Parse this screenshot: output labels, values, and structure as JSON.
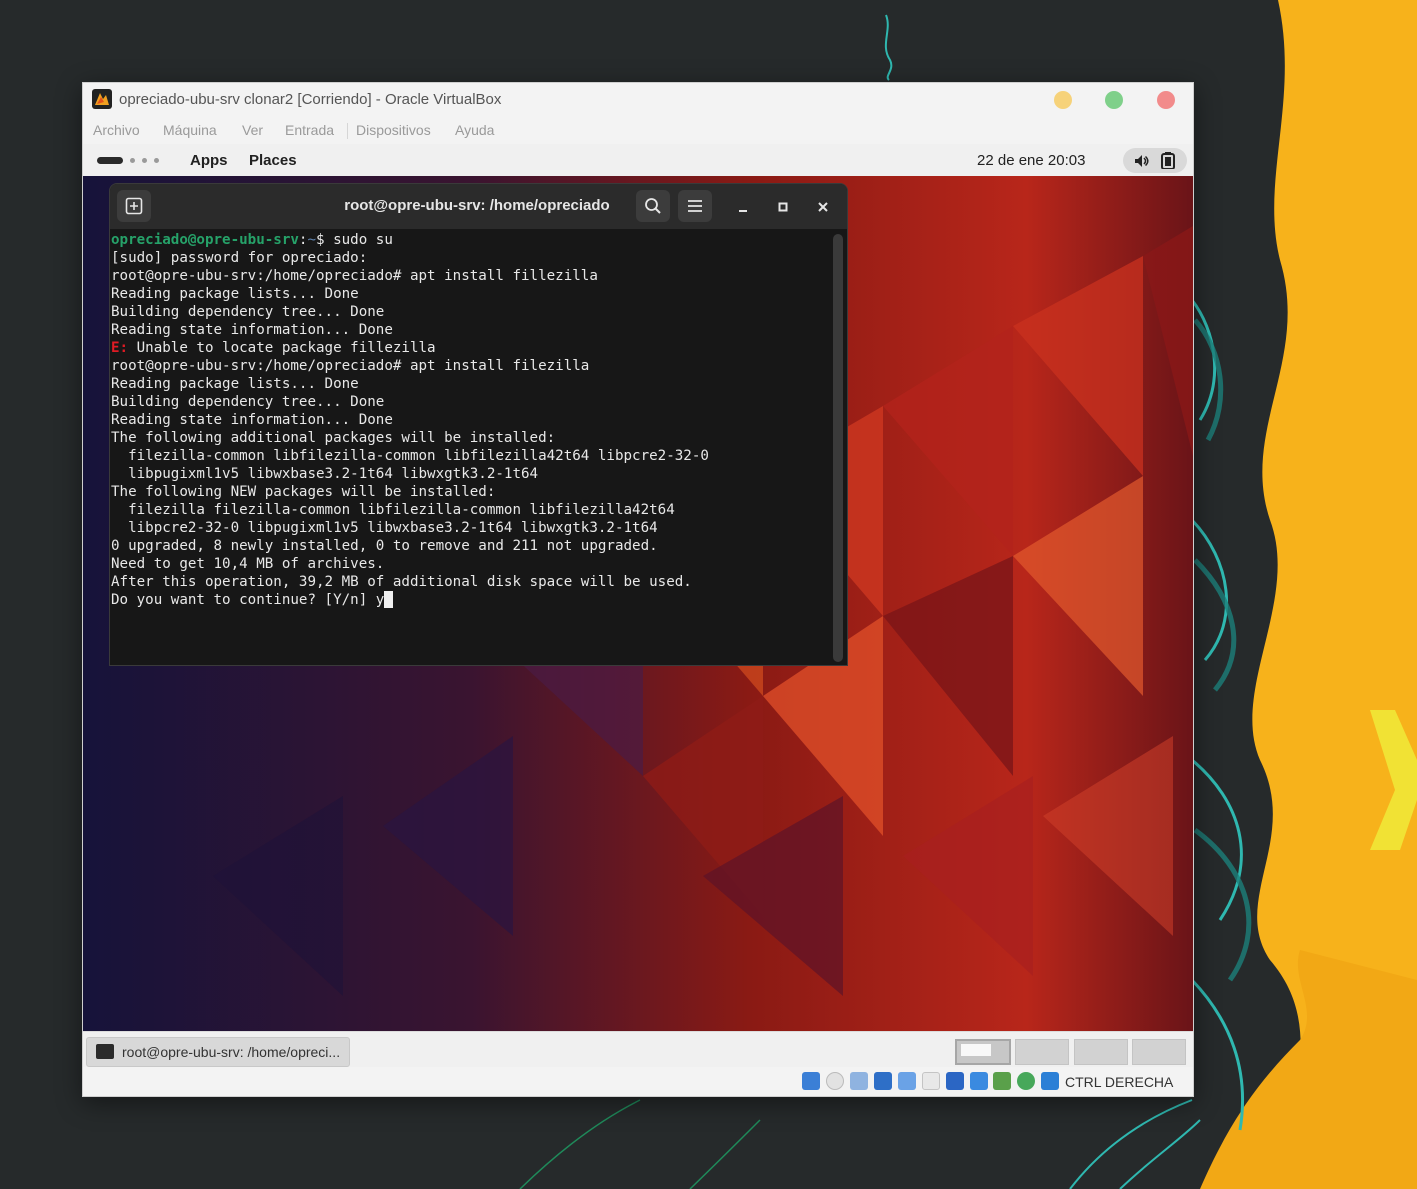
{
  "vbox": {
    "title": "opreciado-ubu-srv clonar2 [Corriendo] - Oracle VirtualBox",
    "menu": [
      "Archivo",
      "Máquina",
      "Ver",
      "Entrada",
      "Dispositivos",
      "Ayuda"
    ]
  },
  "gnome": {
    "apps": "Apps",
    "places": "Places",
    "clock": "22 de ene  20:03"
  },
  "terminal": {
    "title": "root@opre-ubu-srv: /home/opreciado",
    "prompt_user": "opreciado@opre-ubu-srv",
    "prompt_sep": ":",
    "prompt_path": "~",
    "prompt_cmd": "$ sudo su",
    "error_prefix": "E:",
    "error_msg": " Unable to locate package fillezilla",
    "lines": [
      "[sudo] password for opreciado:",
      "root@opre-ubu-srv:/home/opreciado# apt install fillezilla",
      "Reading package lists... Done",
      "Building dependency tree... Done",
      "Reading state information... Done",
      "root@opre-ubu-srv:/home/opreciado# apt install filezilla",
      "Reading package lists... Done",
      "Building dependency tree... Done",
      "Reading state information... Done",
      "The following additional packages will be installed:",
      "  filezilla-common libfilezilla-common libfilezilla42t64 libpcre2-32-0",
      "  libpugixml1v5 libwxbase3.2-1t64 libwxgtk3.2-1t64",
      "The following NEW packages will be installed:",
      "  filezilla filezilla-common libfilezilla-common libfilezilla42t64",
      "  libpcre2-32-0 libpugixml1v5 libwxbase3.2-1t64 libwxgtk3.2-1t64",
      "0 upgraded, 8 newly installed, 0 to remove and 211 not upgraded.",
      "Need to get 10,4 MB of archives.",
      "After this operation, 39,2 MB of additional disk space will be used.",
      "Do you want to continue? [Y/n] y"
    ]
  },
  "taskbar": {
    "task_label": "root@opre-ubu-srv: /home/opreci..."
  },
  "statusbar": {
    "host_key": "CTRL DERECHA"
  },
  "colors": {
    "prompt_green": "#26a269",
    "error_red": "#e01b24",
    "terminal_bg": "#171717",
    "host_accent_yellow": "#f7b21b"
  }
}
